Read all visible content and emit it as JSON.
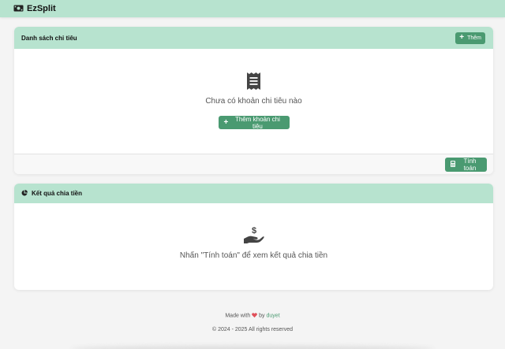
{
  "app": {
    "title": "EzSplit"
  },
  "expenses_card": {
    "title": "Danh sách chi tiêu",
    "add_label": "Thêm",
    "empty_text": "Chưa có khoản chi tiêu nào",
    "add_expense_label": "Thêm khoản chi tiêu",
    "calculate_label": "Tính toán"
  },
  "results_card": {
    "title": "Kết quả chia tiền",
    "empty_text": "Nhấn \"Tính toán\" để xem kết quả chia tiền"
  },
  "footer": {
    "made_with": "Made with",
    "by": "by",
    "author": "duyet",
    "copyright": "© 2024 - 2025 All rights reserved"
  },
  "colors": {
    "header_bg": "#b7e3cf",
    "accent": "#4a9a71",
    "heart": "#e0505a"
  },
  "icons": {
    "brand": "money-bill-icon",
    "add": "plus-icon",
    "empty_expenses": "receipt-icon",
    "calculate": "calculator-icon",
    "results": "pie-chart-icon",
    "empty_results": "hand-holding-dollar-icon",
    "heart": "heart-icon"
  }
}
